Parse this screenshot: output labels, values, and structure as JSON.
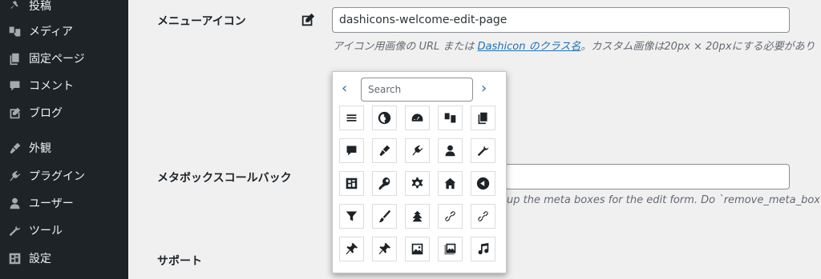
{
  "sidebar": {
    "items": [
      {
        "label": "投稿",
        "icon": "pushpin-icon"
      },
      {
        "label": "メディア",
        "icon": "media-icon"
      },
      {
        "label": "固定ページ",
        "icon": "pages-icon"
      },
      {
        "label": "コメント",
        "icon": "comment-icon"
      },
      {
        "label": "ブログ",
        "icon": "edit-page-icon"
      },
      {
        "label": "外観",
        "icon": "appearance-icon"
      },
      {
        "label": "プラグイン",
        "icon": "plugins-icon"
      },
      {
        "label": "ユーザー",
        "icon": "users-icon"
      },
      {
        "label": "ツール",
        "icon": "tools-icon"
      },
      {
        "label": "設定",
        "icon": "settings-icon"
      }
    ]
  },
  "form": {
    "menu_icon_label": "メニューアイコン",
    "menu_icon_value": "dashicons-welcome-edit-page",
    "menu_icon_desc_prefix": "アイコン用画像の URL または ",
    "menu_icon_desc_link": "Dashicon のクラス名",
    "menu_icon_desc_suffix": "。カスタム画像は20px × 20pxにする必要があり",
    "metabox_label": "メタボックスコールバック",
    "metabox_desc": "up the meta boxes for the edit form. Do `remove_meta_box()` and",
    "support_label": "サポート"
  },
  "picker": {
    "search_placeholder": "Search",
    "prev": "‹",
    "next": "›",
    "icons": [
      "menu-icon",
      "globe-icon",
      "dashboard-icon",
      "media-icon",
      "pages-icon",
      "comment-icon",
      "appearance-icon",
      "plugins-icon",
      "users-icon",
      "tools-icon",
      "settings-icon",
      "key-icon",
      "gear-icon",
      "home-icon",
      "back-icon",
      "filter-icon",
      "brush-icon",
      "buddicons-icon",
      "link-icon",
      "link-alt-icon",
      "pin-icon",
      "pin-alt-icon",
      "image-icon",
      "gallery-icon",
      "music-icon"
    ]
  }
}
